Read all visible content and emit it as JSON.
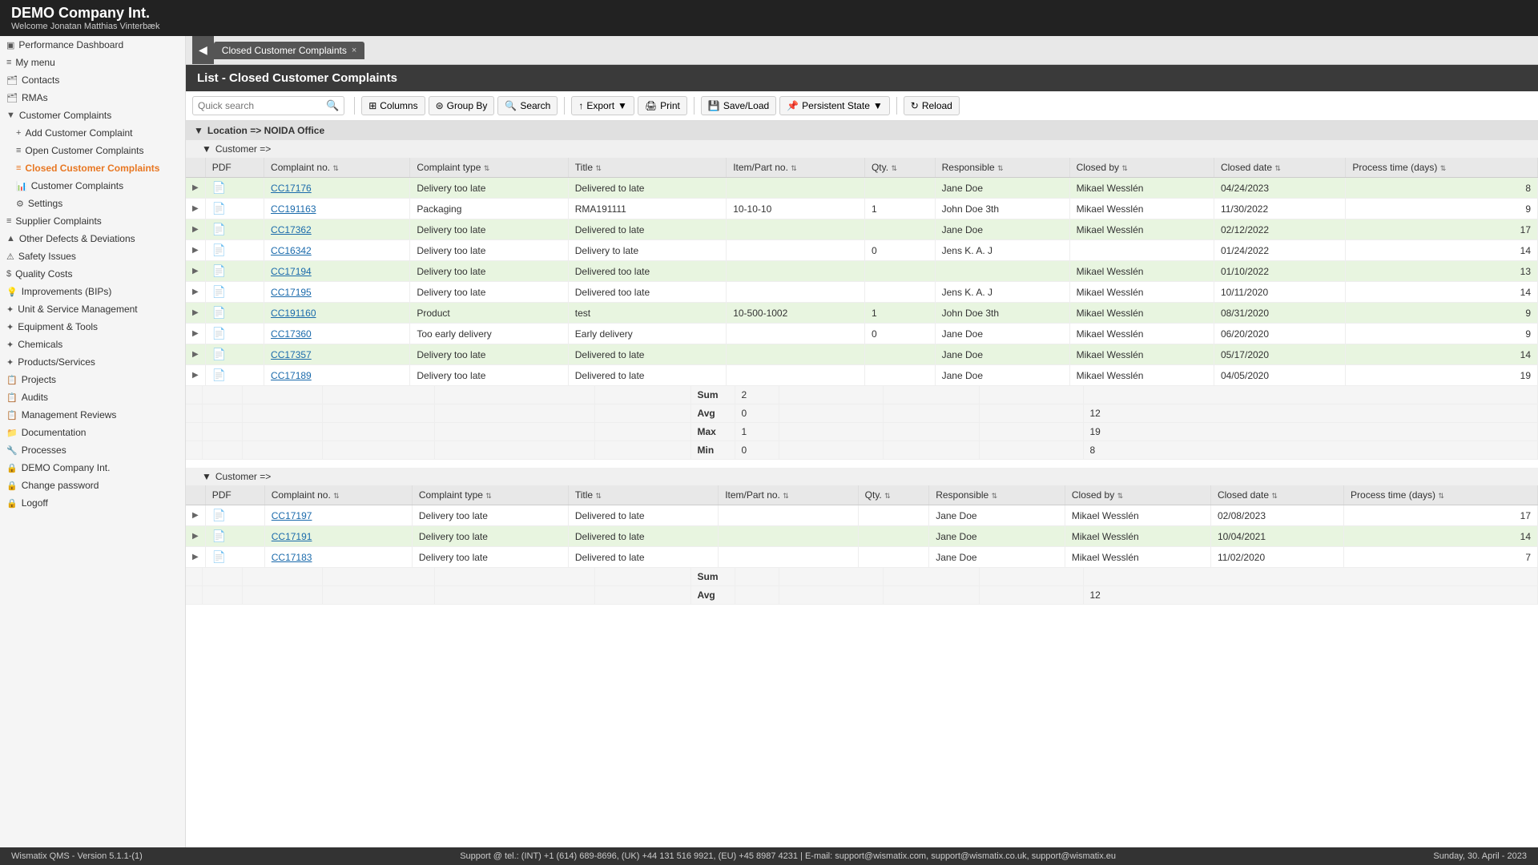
{
  "app": {
    "title": "DEMO Company Int.",
    "welcome": "Welcome Jonatan Matthias Vinterbæk"
  },
  "sidebar": {
    "items": [
      {
        "id": "performance-dashboard",
        "label": "Performance Dashboard",
        "icon": "▣",
        "indent": 0
      },
      {
        "id": "my-menu",
        "label": "My menu",
        "icon": "≡",
        "indent": 0
      },
      {
        "id": "contacts",
        "label": "Contacts",
        "icon": "🗂",
        "indent": 0
      },
      {
        "id": "rmas",
        "label": "RMAs",
        "icon": "🗂",
        "indent": 0
      },
      {
        "id": "customer-complaints",
        "label": "Customer Complaints",
        "icon": "▶",
        "indent": 0
      },
      {
        "id": "add-customer-complaint",
        "label": "Add Customer Complaint",
        "icon": "+",
        "indent": 1
      },
      {
        "id": "open-customer-complaints",
        "label": "Open Customer Complaints",
        "icon": "≡",
        "indent": 1
      },
      {
        "id": "closed-customer-complaints",
        "label": "Closed Customer Complaints",
        "icon": "≡",
        "indent": 1,
        "active": true
      },
      {
        "id": "customer-complaints-sub",
        "label": "Customer Complaints",
        "icon": "📊",
        "indent": 1
      },
      {
        "id": "settings",
        "label": "Settings",
        "icon": "⚙",
        "indent": 1
      },
      {
        "id": "supplier-complaints",
        "label": "Supplier Complaints",
        "icon": "≡",
        "indent": 0
      },
      {
        "id": "other-defects",
        "label": "Other Defects & Deviations",
        "icon": "▲",
        "indent": 0
      },
      {
        "id": "safety-issues",
        "label": "Safety Issues",
        "icon": "!",
        "indent": 0
      },
      {
        "id": "quality-costs",
        "label": "Quality Costs",
        "icon": "$",
        "indent": 0
      },
      {
        "id": "improvements",
        "label": "Improvements (BIPs)",
        "icon": "💡",
        "indent": 0
      },
      {
        "id": "unit-service",
        "label": "Unit & Service Management",
        "icon": "✦",
        "indent": 0
      },
      {
        "id": "equipment-tools",
        "label": "Equipment & Tools",
        "icon": "✦",
        "indent": 0
      },
      {
        "id": "chemicals",
        "label": "Chemicals",
        "icon": "✦",
        "indent": 0
      },
      {
        "id": "products-services",
        "label": "Products/Services",
        "icon": "✦",
        "indent": 0
      },
      {
        "id": "projects",
        "label": "Projects",
        "icon": "📋",
        "indent": 0
      },
      {
        "id": "audits",
        "label": "Audits",
        "icon": "📋",
        "indent": 0
      },
      {
        "id": "management-reviews",
        "label": "Management Reviews",
        "icon": "📋",
        "indent": 0
      },
      {
        "id": "documentation",
        "label": "Documentation",
        "icon": "📁",
        "indent": 0
      },
      {
        "id": "processes",
        "label": "Processes",
        "icon": "🔧",
        "indent": 0
      },
      {
        "id": "demo-company",
        "label": "DEMO Company Int.",
        "icon": "🔒",
        "indent": 0
      },
      {
        "id": "change-password",
        "label": "Change password",
        "icon": "🔒",
        "indent": 0
      },
      {
        "id": "logoff",
        "label": "Logoff",
        "icon": "🔒",
        "indent": 0
      }
    ]
  },
  "tab": {
    "label": "Closed Customer Complaints",
    "close_icon": "×"
  },
  "page_title": "List - Closed Customer Complaints",
  "toolbar": {
    "search_placeholder": "Quick search",
    "columns_label": "Columns",
    "group_by_label": "Group By",
    "search_label": "Search",
    "export_label": "Export",
    "print_label": "Print",
    "save_load_label": "Save/Load",
    "persistent_state_label": "Persistent State",
    "reload_label": "Reload"
  },
  "section1": {
    "label": "Location => NOIDA Office",
    "subsection": "Customer =>"
  },
  "columns": [
    "PDF",
    "Complaint no.",
    "Complaint type",
    "Title",
    "Item/Part no.",
    "Qty.",
    "Responsible",
    "Closed by",
    "Closed date",
    "Process time (days)"
  ],
  "rows1": [
    {
      "expand": "▶",
      "pdf": "PDF",
      "no": "CC17176",
      "type": "Delivery too late",
      "title": "Delivered to late",
      "item": "",
      "qty": "",
      "responsible": "Jane Doe",
      "closed_by": "Mikael Wesslén",
      "closed_date": "04/24/2023",
      "process_time": "8",
      "highlight": true
    },
    {
      "expand": "▶",
      "pdf": "PDF",
      "no": "CC191163",
      "type": "Packaging",
      "title": "RMA191111",
      "item": "10-10-10",
      "qty": "1",
      "responsible": "John Doe 3th",
      "closed_by": "Mikael Wesslén",
      "closed_date": "11/30/2022",
      "process_time": "9",
      "highlight": false
    },
    {
      "expand": "▶",
      "pdf": "PDF",
      "no": "CC17362",
      "type": "Delivery too late",
      "title": "Delivered to late",
      "item": "",
      "qty": "",
      "responsible": "Jane Doe",
      "closed_by": "Mikael Wesslén",
      "closed_date": "02/12/2022",
      "process_time": "17",
      "highlight": true
    },
    {
      "expand": "▶",
      "pdf": "PDF",
      "no": "CC16342",
      "type": "Delivery too late",
      "title": "Delivery to late",
      "item": "",
      "qty": "0",
      "responsible": "Jens K. A. J",
      "closed_by": "",
      "closed_date": "01/24/2022",
      "process_time": "14",
      "highlight": false
    },
    {
      "expand": "▶",
      "pdf": "PDF",
      "no": "CC17194",
      "type": "Delivery too late",
      "title": "Delivered too late",
      "item": "",
      "qty": "",
      "responsible": "",
      "closed_by": "Mikael Wesslén",
      "closed_date": "01/10/2022",
      "process_time": "13",
      "highlight": true
    },
    {
      "expand": "▶",
      "pdf": "PDF",
      "no": "CC17195",
      "type": "Delivery too late",
      "title": "Delivered too late",
      "item": "",
      "qty": "",
      "responsible": "Jens K. A. J",
      "closed_by": "Mikael Wesslén",
      "closed_date": "10/11/2020",
      "process_time": "14",
      "highlight": false
    },
    {
      "expand": "▶",
      "pdf": "PDF",
      "no": "CC191160",
      "type": "Product",
      "title": "test",
      "item": "10-500-1002",
      "qty": "1",
      "responsible": "John Doe 3th",
      "closed_by": "Mikael Wesslén",
      "closed_date": "08/31/2020",
      "process_time": "9",
      "highlight": true
    },
    {
      "expand": "▶",
      "pdf": "PDF",
      "no": "CC17360",
      "type": "Too early delivery",
      "title": "Early delivery",
      "item": "",
      "qty": "0",
      "responsible": "Jane Doe",
      "closed_by": "Mikael Wesslén",
      "closed_date": "06/20/2020",
      "process_time": "9",
      "highlight": false
    },
    {
      "expand": "▶",
      "pdf": "PDF",
      "no": "CC17357",
      "type": "Delivery too late",
      "title": "Delivered to late",
      "item": "",
      "qty": "",
      "responsible": "Jane Doe",
      "closed_by": "Mikael Wesslén",
      "closed_date": "05/17/2020",
      "process_time": "14",
      "highlight": true
    },
    {
      "expand": "▶",
      "pdf": "PDF",
      "no": "CC17189",
      "type": "Delivery too late",
      "title": "Delivered to late",
      "item": "",
      "qty": "",
      "responsible": "Jane Doe",
      "closed_by": "Mikael Wesslén",
      "closed_date": "04/05/2020",
      "process_time": "19",
      "highlight": false
    }
  ],
  "summary1": {
    "sum_qty": "2",
    "sum_process": "",
    "avg_qty": "0",
    "avg_process": "12",
    "max_qty": "1",
    "max_process": "19",
    "min_qty": "0",
    "min_process": "8"
  },
  "section2": {
    "subsection": "Customer =>"
  },
  "rows2": [
    {
      "expand": "▶",
      "pdf": "PDF",
      "no": "CC17197",
      "type": "Delivery too late",
      "title": "Delivered to late",
      "item": "",
      "qty": "",
      "responsible": "Jane Doe",
      "closed_by": "Mikael Wesslén",
      "closed_date": "02/08/2023",
      "process_time": "17",
      "highlight": false
    },
    {
      "expand": "▶",
      "pdf": "PDF",
      "no": "CC17191",
      "type": "Delivery too late",
      "title": "Delivered to late",
      "item": "",
      "qty": "",
      "responsible": "Jane Doe",
      "closed_by": "Mikael Wesslén",
      "closed_date": "10/04/2021",
      "process_time": "14",
      "highlight": true
    },
    {
      "expand": "▶",
      "pdf": "PDF",
      "no": "CC17183",
      "type": "Delivery too late",
      "title": "Delivered to late",
      "item": "",
      "qty": "",
      "responsible": "Jane Doe",
      "closed_by": "Mikael Wesslén",
      "closed_date": "11/02/2020",
      "process_time": "7",
      "highlight": false
    }
  ],
  "summary2_partial": {
    "label": "Avg",
    "avg_process": "12"
  },
  "footer": {
    "version": "Wismatix QMS - Version 5.1.1-(1)",
    "support": "Support @ tel.: (INT) +1 (614) 689-8696, (UK) +44 131 516 9921, (EU) +45 8987 4231  |  E-mail: support@wismatix.com, support@wismatix.co.uk, support@wismatix.eu",
    "date": "Sunday, 30. April - 2023"
  }
}
